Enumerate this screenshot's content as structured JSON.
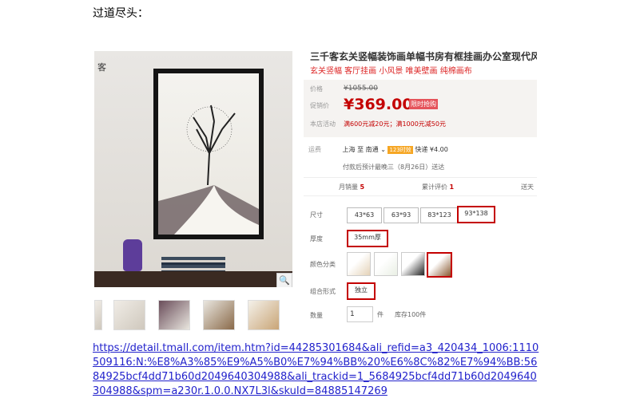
{
  "heading": "过道尽头：",
  "brand_text": "客",
  "product": {
    "title": "三千客玄关竖幅装饰画单幅书房有框挂画办公室现代风景",
    "subtitle": "玄关竖幅 客厅挂画 小风景 唯美壁画 纯棉画布",
    "price_label": "价格",
    "old_price": "¥1055.00",
    "promo_label": "促销价",
    "promo_price": "¥369.00",
    "flash_tag": "限时抢购",
    "store_promo_label": "本店活动",
    "store_promo": "满600元减20元；满1000元减50元",
    "ship_label": "运费",
    "ship_route": "上海 至 南通",
    "ship_badge": "123时效",
    "ship_fee": "快递 ¥4.00",
    "eta": "付款后预计最晚三（8月26日）送达",
    "monthly_label": "月销量",
    "monthly_value": "5",
    "reviews_label": "累计评价",
    "reviews_value": "1",
    "send_label": "送天",
    "size_label": "尺寸",
    "sizes": [
      "43*63",
      "63*93",
      "83*123",
      "93*138"
    ],
    "thickness_label": "厚度",
    "thickness": "35mm厚",
    "color_label": "颜色分类",
    "combo_label": "组合形式",
    "combo": "独立",
    "qty_label": "数量",
    "qty": "1",
    "qty_unit": "件",
    "stock": "库存100件",
    "zoom_icon": "🔍"
  },
  "link": "https://detail.tmall.com/item.htm?id=44285301684&ali_refid=a3_420434_1006:1110509116:N:%E8%A3%85%E9%A5%B0%E7%94%BB%20%E6%8C%82%E7%94%BB:5684925bcf4dd71b60d2049640304988&ali_trackid=1_5684925bcf4dd71b60d2049640304988&spm=a230r.1.0.0.NX7L3l&skuId=84885147269"
}
